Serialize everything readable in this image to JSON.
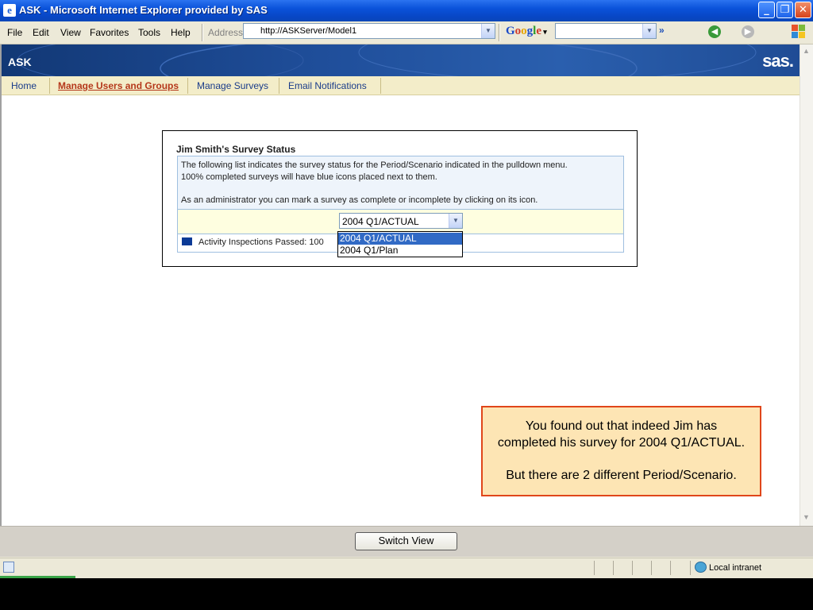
{
  "window": {
    "title": "ASK - Microsoft Internet Explorer provided by SAS"
  },
  "menu": {
    "file": "File",
    "edit": "Edit",
    "view": "View",
    "favorites": "Favorites",
    "tools": "Tools",
    "help": "Help"
  },
  "address": {
    "label": "Address",
    "url": "http://ASKServer/Model1"
  },
  "toolbar": {
    "google": "Google",
    "more": "»"
  },
  "app": {
    "name": "ASK",
    "brand": "sas."
  },
  "tabs": [
    {
      "label": "Home",
      "active": false
    },
    {
      "label": "Manage Users and Groups",
      "active": true
    },
    {
      "label": "Manage Surveys",
      "active": false
    },
    {
      "label": "Email Notifications",
      "active": false
    }
  ],
  "survey": {
    "title": "Jim Smith's Survey Status",
    "info_line1": "The following list indicates the survey status for the Period/Scenario indicated in the pulldown menu.",
    "info_line2": "100% completed surveys will have blue icons placed next to them.",
    "info_line3": "As an administrator you can mark a survey as complete or incomplete by clicking on its icon.",
    "selected": "2004 Q1/ACTUAL",
    "options": [
      "2004 Q1/ACTUAL",
      "2004 Q1/Plan"
    ],
    "status_item": "Activity Inspections Passed: 100"
  },
  "callout": {
    "line1": "You found out that indeed Jim has",
    "line2": "completed his survey for 2004 Q1/ACTUAL.",
    "line3": "But there are 2 different Period/Scenario."
  },
  "footer": {
    "switch_view": "Switch View"
  },
  "status": {
    "zone": "Local intranet"
  },
  "colors": {
    "title_bar": "#0a52d9",
    "header": "#1f4e9a",
    "tab_bar": "#f3edc9",
    "active_tab": "#b5371a",
    "callout_border": "#e0461a",
    "callout_fill": "#fde5b4",
    "selected_option": "#316ac5"
  }
}
